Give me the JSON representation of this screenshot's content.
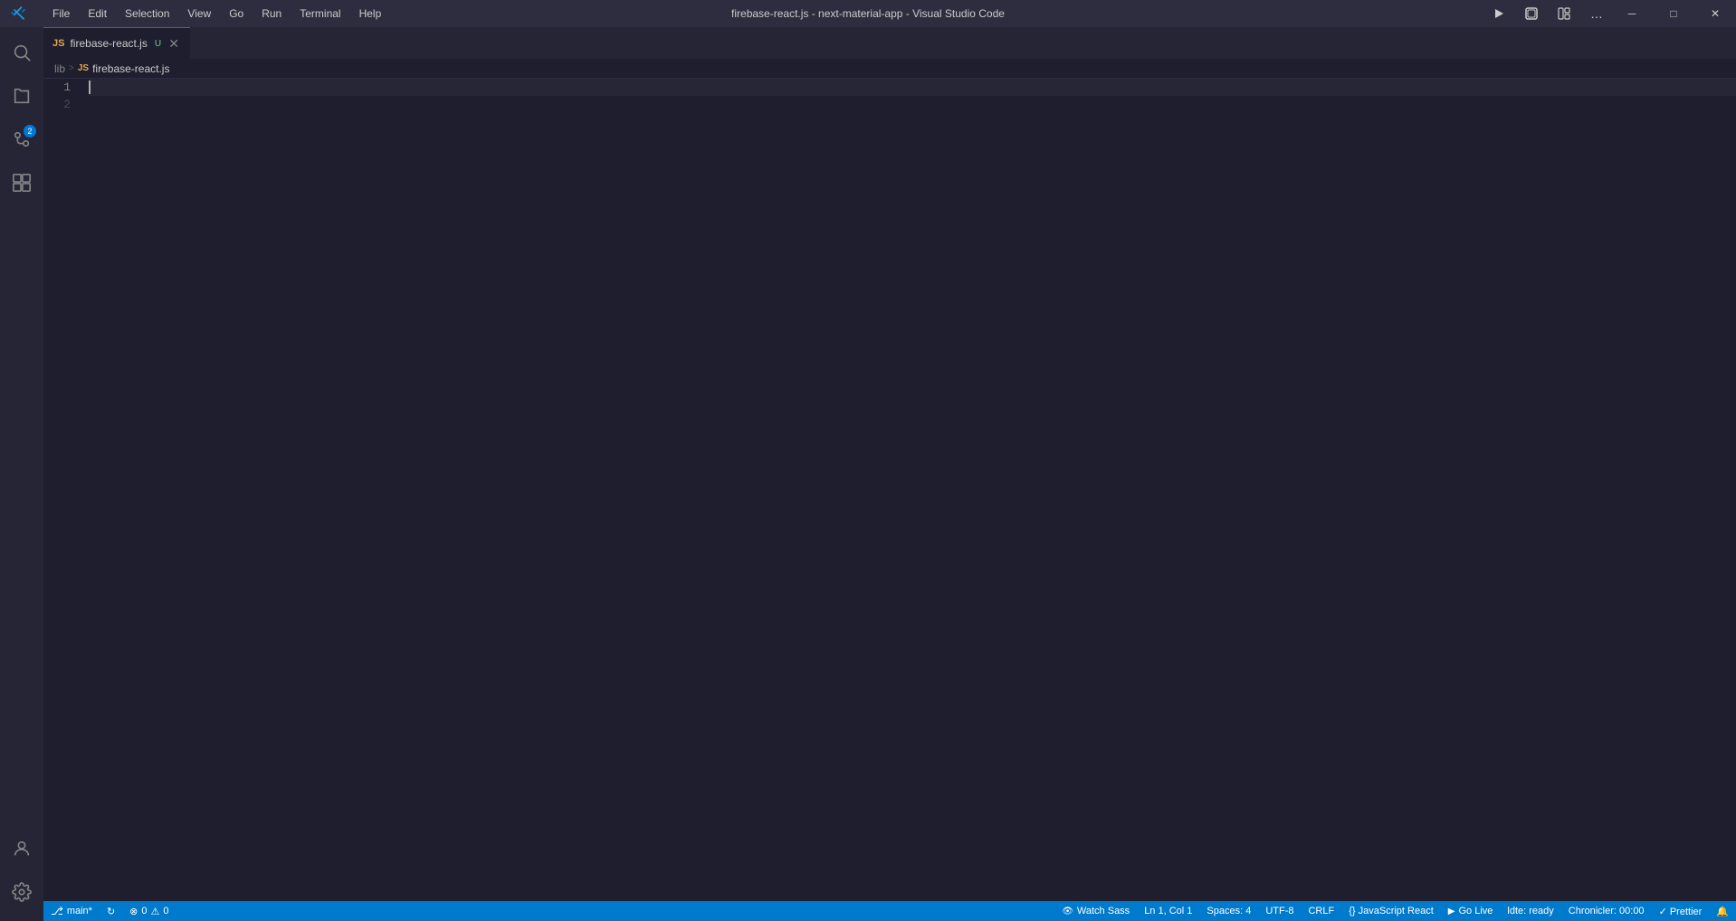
{
  "titleBar": {
    "title": "firebase-react.js - next-material-app - Visual Studio Code",
    "menuItems": [
      "File",
      "Edit",
      "Selection",
      "View",
      "Go",
      "Run",
      "Terminal",
      "Help"
    ],
    "windowControls": {
      "minimize": "─",
      "maximize": "□",
      "close": "✕"
    }
  },
  "activityBar": {
    "icons": [
      {
        "name": "search",
        "label": "search-icon",
        "glyph": "🔍",
        "active": false
      },
      {
        "name": "explorer",
        "label": "explorer-icon",
        "glyph": "⎘",
        "active": false
      },
      {
        "name": "source-control",
        "label": "source-control-icon",
        "glyph": "⎇",
        "active": false,
        "badge": "2"
      },
      {
        "name": "extensions",
        "label": "extensions-icon",
        "glyph": "⊞",
        "active": false
      }
    ],
    "bottomIcons": [
      {
        "name": "account",
        "label": "account-icon",
        "glyph": "👤"
      },
      {
        "name": "settings",
        "label": "settings-icon",
        "glyph": "⚙"
      }
    ]
  },
  "tabs": [
    {
      "label": "firebase-react.js",
      "modified": true,
      "active": true,
      "icon": "js-file-icon"
    }
  ],
  "breadcrumb": {
    "items": [
      "lib",
      "firebase-react.js"
    ]
  },
  "editor": {
    "lineCount": 2,
    "lines": [
      "",
      ""
    ]
  },
  "statusBar": {
    "left": [
      {
        "name": "branch-item",
        "icon": "⎇",
        "text": "main*"
      },
      {
        "name": "sync-item",
        "icon": "↻",
        "text": ""
      },
      {
        "name": "errors-item",
        "icon": "⊗",
        "text": "0"
      },
      {
        "name": "warnings-item",
        "icon": "⚠",
        "text": "0"
      }
    ],
    "right": [
      {
        "name": "watch-sass-item",
        "text": "Watch Sass"
      },
      {
        "name": "line-col-item",
        "text": "Ln 1, Col 1"
      },
      {
        "name": "spaces-item",
        "text": "Spaces: 4"
      },
      {
        "name": "encoding-item",
        "text": "UTF-8"
      },
      {
        "name": "eol-item",
        "text": "CRLF"
      },
      {
        "name": "language-item",
        "text": "{} JavaScript React"
      },
      {
        "name": "go-live-item",
        "text": "Go Live"
      },
      {
        "name": "ldte-item",
        "text": "ldte: ready"
      },
      {
        "name": "chronicler-item",
        "text": "Chronicler: 00:00"
      },
      {
        "name": "prettier-item",
        "text": "✓ Prettier"
      }
    ]
  }
}
